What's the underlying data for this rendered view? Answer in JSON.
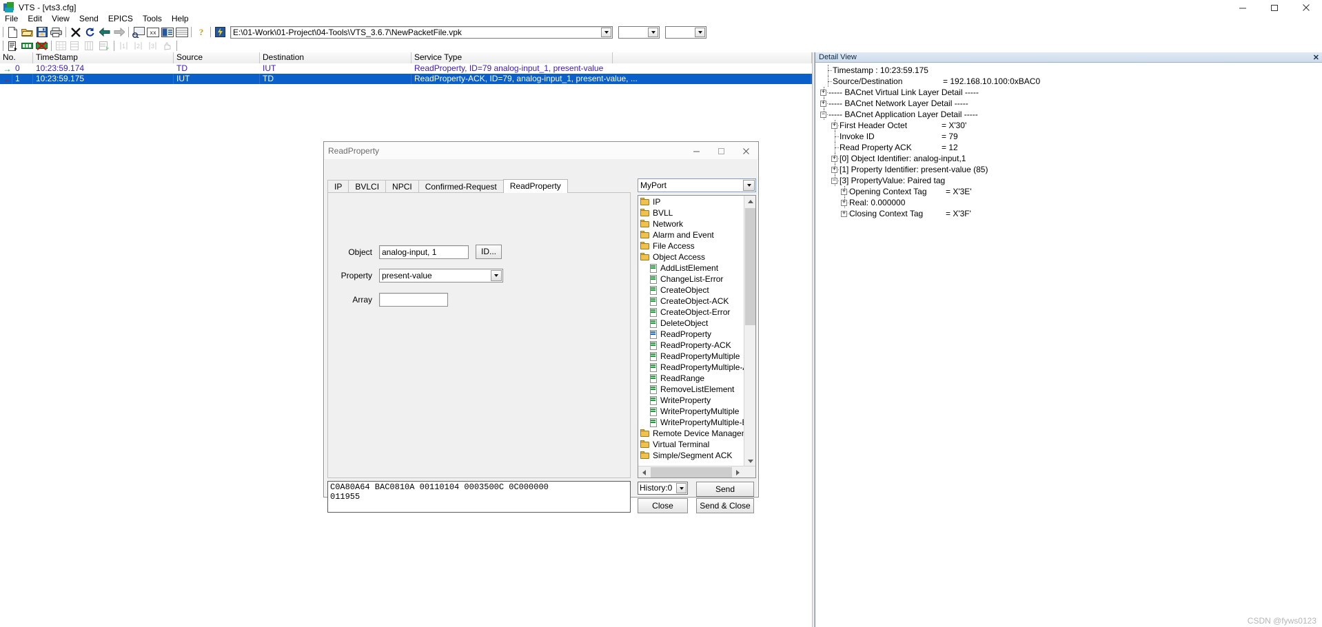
{
  "window": {
    "title": "VTS - [vts3.cfg]",
    "app_icon": "vts-app-icon",
    "minimize": "minimize-icon",
    "maximize": "maximize-icon",
    "close": "close-icon"
  },
  "menu": {
    "items": [
      "File",
      "Edit",
      "View",
      "Send",
      "EPICS",
      "Tools",
      "Help"
    ]
  },
  "toolbar1": {
    "icons": [
      "new-document-icon",
      "open-folder-icon",
      "save-disk-icon",
      "print-icon",
      "delete-x-icon",
      "refresh-icon",
      "back-arrow-icon",
      "forward-arrow-icon",
      "capture-icon",
      "hex-view-icon",
      "detail-view-icon",
      "list-view-icon",
      "help-question-icon",
      "send-packet-icon"
    ],
    "path_value": "E:\\01-Work\\01-Project\\04-Tools\\VTS_3.6.7\\NewPacketFile.vpk"
  },
  "toolbar2": {
    "icons": [
      "script-icon",
      "start-test-icon",
      "stop-test-icon",
      "grid-icon",
      "table-row-icon",
      "table-col-icon",
      "filter-icon",
      "step1-icon",
      "step2-icon",
      "step3-icon",
      "hand-icon"
    ]
  },
  "packet_list": {
    "columns": [
      "No.",
      "TimeStamp",
      "Source",
      "Destination",
      "Service Type"
    ],
    "rows": [
      {
        "dir": "→",
        "no": "0",
        "timestamp": "10:23:59.174",
        "source": "TD",
        "destination": "IUT",
        "service_type": "ReadProperty, ID=79 analog-input_1, present-value",
        "selected": false
      },
      {
        "dir": "←",
        "no": "1",
        "timestamp": "10:23:59.175",
        "source": "IUT",
        "destination": "TD",
        "service_type": "ReadProperty-ACK, ID=79, analog-input_1, present-value, ...",
        "selected": true
      }
    ]
  },
  "detail_view": {
    "title": "Detail View",
    "close": "close-icon",
    "nodes": [
      {
        "depth": 0,
        "toggle": "none",
        "text": "Timestamp : 10:23:59.175"
      },
      {
        "depth": 0,
        "toggle": "none",
        "text": "Source/Destination",
        "value": "= 192.168.10.100:0xBAC0"
      },
      {
        "depth": 0,
        "toggle": "plus",
        "text": "----- BACnet Virtual Link Layer Detail -----"
      },
      {
        "depth": 0,
        "toggle": "plus",
        "text": "----- BACnet Network Layer Detail -----"
      },
      {
        "depth": 0,
        "toggle": "minus",
        "text": "----- BACnet Application Layer Detail -----"
      },
      {
        "depth": 1,
        "toggle": "plus",
        "text": "First Header Octet",
        "value": "= X'30'"
      },
      {
        "depth": 1,
        "toggle": "none",
        "text": "Invoke ID",
        "value": "= 79"
      },
      {
        "depth": 1,
        "toggle": "none",
        "text": "Read Property ACK",
        "value": "= 12"
      },
      {
        "depth": 1,
        "toggle": "plus",
        "text": "[0] Object Identifier:  analog-input,1"
      },
      {
        "depth": 1,
        "toggle": "plus",
        "text": "[1] Property Identifier:  present-value (85)"
      },
      {
        "depth": 1,
        "toggle": "minus",
        "text": "[3] PropertyValue:  Paired tag"
      },
      {
        "depth": 2,
        "toggle": "plus",
        "text": "Opening Context Tag",
        "value": "= X'3E'"
      },
      {
        "depth": 2,
        "toggle": "plus",
        "text": "Real:  0.000000"
      },
      {
        "depth": 2,
        "toggle": "plus",
        "text": "Closing Context Tag",
        "value": "= X'3F'"
      }
    ]
  },
  "dialog": {
    "title": "ReadProperty",
    "minimize": "minimize-icon",
    "maximize": "maximize-icon",
    "close": "close-icon",
    "tabs": [
      {
        "label": "IP",
        "active": false
      },
      {
        "label": "BVLCI",
        "active": false
      },
      {
        "label": "NPCI",
        "active": false
      },
      {
        "label": "Confirmed-Request",
        "active": false
      },
      {
        "label": "ReadProperty",
        "active": true
      }
    ],
    "form": {
      "object_label": "Object",
      "object_value": "analog-input, 1",
      "id_button": "ID...",
      "property_label": "Property",
      "property_value": "present-value",
      "array_label": "Array",
      "array_value": ""
    },
    "port": {
      "selected": "MyPort"
    },
    "service_tree": [
      {
        "label": "IP",
        "type": "folder",
        "indent": 0,
        "selected": false
      },
      {
        "label": "BVLL",
        "type": "folder",
        "indent": 0,
        "selected": false
      },
      {
        "label": "Network",
        "type": "folder",
        "indent": 0,
        "selected": false
      },
      {
        "label": "Alarm and Event",
        "type": "folder",
        "indent": 0,
        "selected": false
      },
      {
        "label": "File Access",
        "type": "folder",
        "indent": 0,
        "selected": false
      },
      {
        "label": "Object Access",
        "type": "folder",
        "indent": 0,
        "selected": false
      },
      {
        "label": "AddListElement",
        "type": "doc",
        "indent": 1,
        "selected": false
      },
      {
        "label": "ChangeList-Error",
        "type": "doc",
        "indent": 1,
        "selected": false
      },
      {
        "label": "CreateObject",
        "type": "doc",
        "indent": 1,
        "selected": false
      },
      {
        "label": "CreateObject-ACK",
        "type": "doc",
        "indent": 1,
        "selected": false
      },
      {
        "label": "CreateObject-Error",
        "type": "doc",
        "indent": 1,
        "selected": false
      },
      {
        "label": "DeleteObject",
        "type": "doc",
        "indent": 1,
        "selected": false
      },
      {
        "label": "ReadProperty",
        "type": "doc",
        "indent": 1,
        "selected": true
      },
      {
        "label": "ReadProperty-ACK",
        "type": "doc",
        "indent": 1,
        "selected": false
      },
      {
        "label": "ReadPropertyMultiple",
        "type": "doc",
        "indent": 1,
        "selected": false
      },
      {
        "label": "ReadPropertyMultiple-ACK",
        "type": "doc",
        "indent": 1,
        "selected": false
      },
      {
        "label": "ReadRange",
        "type": "doc",
        "indent": 1,
        "selected": false
      },
      {
        "label": "RemoveListElement",
        "type": "doc",
        "indent": 1,
        "selected": false
      },
      {
        "label": "WriteProperty",
        "type": "doc",
        "indent": 1,
        "selected": false
      },
      {
        "label": "WritePropertyMultiple",
        "type": "doc",
        "indent": 1,
        "selected": false
      },
      {
        "label": "WritePropertyMultiple-Error",
        "type": "doc",
        "indent": 1,
        "selected": false
      },
      {
        "label": "Remote Device Management",
        "type": "folder",
        "indent": 0,
        "selected": false
      },
      {
        "label": "Virtual Terminal",
        "type": "folder",
        "indent": 0,
        "selected": false
      },
      {
        "label": "Simple/Segment ACK",
        "type": "folder",
        "indent": 0,
        "selected": false
      }
    ],
    "hex_lines": [
      "C0A80A64 BAC0810A 00110104 0003500C 0C000000",
      "011955"
    ],
    "history_label": "History:0",
    "buttons": {
      "send": "Send",
      "close": "Close",
      "send_and_close": "Send & Close"
    }
  },
  "watermark": "CSDN @fyws0123"
}
